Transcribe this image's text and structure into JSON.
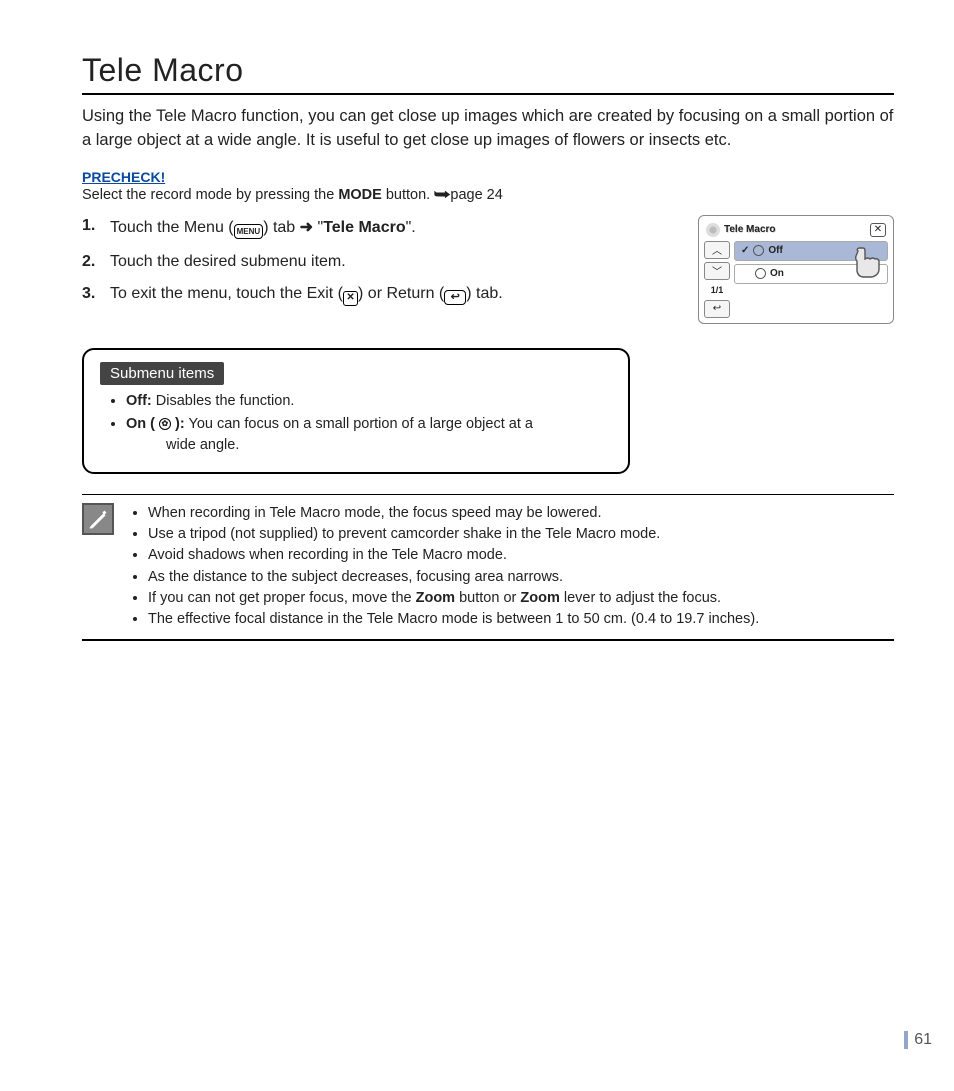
{
  "title": "Tele Macro",
  "intro": "Using the Tele Macro function, you can get close up images which are created by focusing on a small portion of a large object at a wide angle. It is useful to get close up images of flowers or insects etc.",
  "precheck": {
    "label": "PRECHECK!",
    "text_pre": "Select the record mode by pressing the ",
    "mode_word": "MODE",
    "text_post": " button. ",
    "page_ref": "page 24"
  },
  "steps": [
    {
      "num": "1.",
      "pre": "Touch the Menu (",
      "icon_label": "MENU",
      "mid": ") tab ",
      "arrow": "➜",
      "post_pre": " \"",
      "target": "Tele Macro",
      "post_suf": "\"."
    },
    {
      "num": "2.",
      "text": "Touch the desired submenu item."
    },
    {
      "num": "3.",
      "pre": "To exit the menu, touch the Exit (",
      "icon1": "✕",
      "mid": ") or Return (",
      "icon2": "↩",
      "post": ") tab."
    }
  ],
  "screen": {
    "title": "Tele Macro",
    "close": "✕",
    "up": "︿",
    "down": "﹀",
    "page": "1/1",
    "return": "↩",
    "row_off": "Off",
    "row_on": "On",
    "check": "✓"
  },
  "submenu": {
    "tag": "Submenu items",
    "off_label": "Off:",
    "off_text": " Disables the function.",
    "on_label": "On ( ",
    "on_label_suffix": " ):",
    "on_text": " You can focus on a small portion of a large object at a",
    "on_text_line2": "wide angle."
  },
  "notes": [
    "When recording in Tele Macro mode, the focus speed may be lowered.",
    "Use a tripod (not supplied) to prevent camcorder shake in the Tele Macro mode.",
    "Avoid shadows when recording in the Tele Macro mode.",
    "As the distance to the subject decreases, focusing area narrows.",
    {
      "pre": "If you can not get proper focus, move the ",
      "b1": "Zoom",
      "mid": " button or ",
      "b2": "Zoom",
      "post": " lever to adjust the focus."
    },
    "The effective focal distance in the Tele Macro mode is between 1 to 50 cm. (0.4 to 19.7 inches)."
  ],
  "page_number": "61"
}
